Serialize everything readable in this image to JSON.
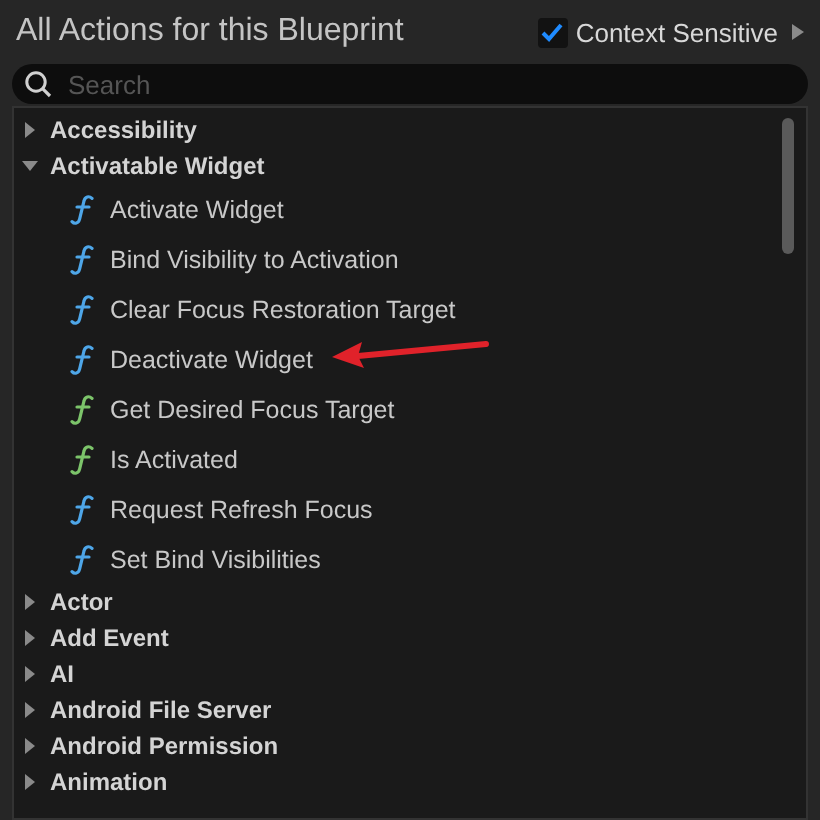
{
  "title": "All Actions for this Blueprint",
  "context_sensitive": {
    "label": "Context Sensitive",
    "checked": true
  },
  "search": {
    "placeholder": "Search"
  },
  "tree": [
    {
      "label": "Accessibility",
      "expanded": false
    },
    {
      "label": "Activatable Widget",
      "expanded": true,
      "children": [
        {
          "label": "Activate Widget",
          "color": "#4ea6e8",
          "pointed": false
        },
        {
          "label": "Bind Visibility to Activation",
          "color": "#4ea6e8",
          "pointed": false
        },
        {
          "label": "Clear Focus Restoration Target",
          "color": "#4ea6e8",
          "pointed": false
        },
        {
          "label": "Deactivate Widget",
          "color": "#4ea6e8",
          "pointed": true
        },
        {
          "label": "Get Desired Focus Target",
          "color": "#7cc46a",
          "pointed": false
        },
        {
          "label": "Is Activated",
          "color": "#7cc46a",
          "pointed": false
        },
        {
          "label": "Request Refresh Focus",
          "color": "#4ea6e8",
          "pointed": false
        },
        {
          "label": "Set Bind Visibilities",
          "color": "#4ea6e8",
          "pointed": false
        }
      ]
    },
    {
      "label": "Actor",
      "expanded": false
    },
    {
      "label": "Add Event",
      "expanded": false
    },
    {
      "label": "AI",
      "expanded": false
    },
    {
      "label": "Android File Server",
      "expanded": false
    },
    {
      "label": "Android Permission",
      "expanded": false
    },
    {
      "label": "Animation",
      "expanded": false
    }
  ]
}
